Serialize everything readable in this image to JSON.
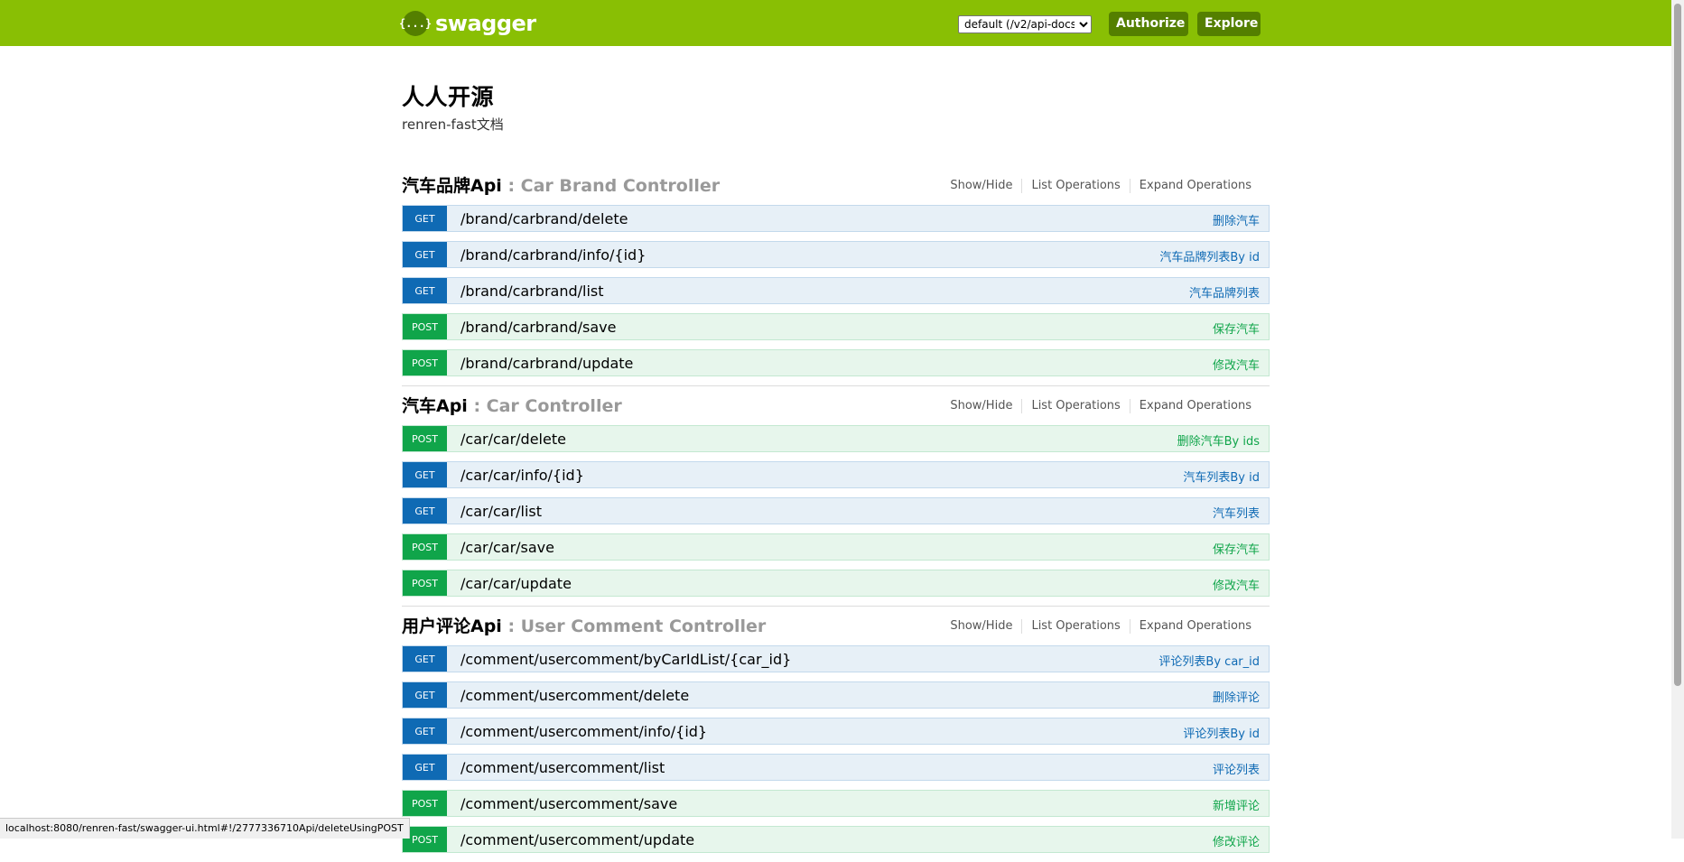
{
  "header": {
    "logo_icon_text": "{...}",
    "logo_text": "swagger",
    "select_value": "default (/v2/api-docs)",
    "authorize_label": "Authorize",
    "explore_label": "Explore",
    "brand_color": "#89bf04"
  },
  "info": {
    "title": "人人开源",
    "description": "renren-fast文档"
  },
  "resources": [
    {
      "name": "汽车品牌Api",
      "separator": " : ",
      "controller": "Car Brand Controller",
      "show_hide": "Show/Hide",
      "list_ops": "List Operations",
      "expand_ops": "Expand Operations",
      "ops": [
        {
          "method": "GET",
          "path": "/brand/carbrand/delete",
          "summary": "删除汽车"
        },
        {
          "method": "GET",
          "path": "/brand/carbrand/info/{id}",
          "summary": "汽车品牌列表By id"
        },
        {
          "method": "GET",
          "path": "/brand/carbrand/list",
          "summary": "汽车品牌列表"
        },
        {
          "method": "POST",
          "path": "/brand/carbrand/save",
          "summary": "保存汽车"
        },
        {
          "method": "POST",
          "path": "/brand/carbrand/update",
          "summary": "修改汽车"
        }
      ]
    },
    {
      "name": "汽车Api",
      "separator": " : ",
      "controller": "Car Controller",
      "show_hide": "Show/Hide",
      "list_ops": "List Operations",
      "expand_ops": "Expand Operations",
      "ops": [
        {
          "method": "POST",
          "path": "/car/car/delete",
          "summary": "删除汽车By ids"
        },
        {
          "method": "GET",
          "path": "/car/car/info/{id}",
          "summary": "汽车列表By id"
        },
        {
          "method": "GET",
          "path": "/car/car/list",
          "summary": "汽车列表"
        },
        {
          "method": "POST",
          "path": "/car/car/save",
          "summary": "保存汽车"
        },
        {
          "method": "POST",
          "path": "/car/car/update",
          "summary": "修改汽车"
        }
      ]
    },
    {
      "name": "用户评论Api",
      "separator": " : ",
      "controller": "User Comment Controller",
      "show_hide": "Show/Hide",
      "list_ops": "List Operations",
      "expand_ops": "Expand Operations",
      "ops": [
        {
          "method": "GET",
          "path": "/comment/usercomment/byCarIdList/{car_id}",
          "summary": "评论列表By car_id"
        },
        {
          "method": "GET",
          "path": "/comment/usercomment/delete",
          "summary": "删除评论"
        },
        {
          "method": "GET",
          "path": "/comment/usercomment/info/{id}",
          "summary": "评论列表By id"
        },
        {
          "method": "GET",
          "path": "/comment/usercomment/list",
          "summary": "评论列表"
        },
        {
          "method": "POST",
          "path": "/comment/usercomment/save",
          "summary": "新增评论"
        },
        {
          "method": "POST",
          "path": "/comment/usercomment/update",
          "summary": "修改评论"
        }
      ]
    }
  ],
  "status_bar": {
    "url": "localhost:8080/renren-fast/swagger-ui.html#!/2777336710Api/deleteUsingPOST"
  },
  "colors": {
    "get": "#0f6ab4",
    "post": "#10a54a"
  }
}
